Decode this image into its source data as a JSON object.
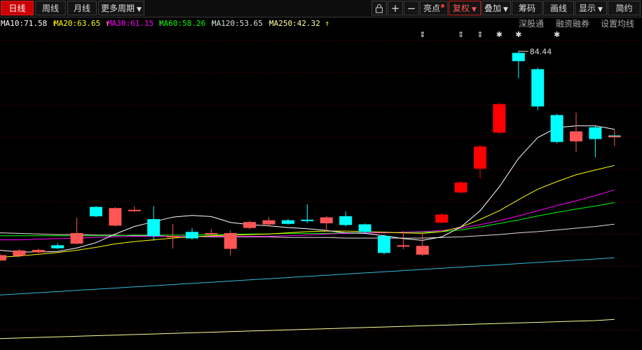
{
  "toolbar": {
    "period_day": "日线",
    "period_week": "周线",
    "period_month": "月线",
    "period_more": "更多周期",
    "lock_icon": "lock-icon",
    "zoom_in": "+",
    "zoom_out": "−",
    "bright_spot": "亮点",
    "adjust": "复权",
    "overlay": "叠加",
    "chips": "筹码",
    "draw_line": "画线",
    "display": "显示",
    "simple": "简约"
  },
  "ma_legend": [
    {
      "label": "MA10:71.58",
      "arrow": "↑",
      "color": "#ffffff"
    },
    {
      "label": "MA20:63.65",
      "arrow": "↑",
      "color": "#ffff00"
    },
    {
      "label": "MA30:61.15",
      "arrow": "↑",
      "color": "#ff00ff"
    },
    {
      "label": "MA60:58.26",
      "arrow": "↑",
      "color": "#00ff00"
    },
    {
      "label": "MA120:53.65",
      "arrow": "↑",
      "color": "#dddddd"
    },
    {
      "label": "MA250:42.32",
      "arrow": "↑",
      "color": "#ffffa0"
    }
  ],
  "links": {
    "shenzhen_connect": "深股通",
    "margin_trading": "融资融券",
    "ma_settings": "设置均线"
  },
  "chart_data": {
    "type": "candlestick",
    "annotations": {
      "max_label": "84.44"
    },
    "colors": {
      "up": "#ff5555",
      "up_strong": "#ff0000",
      "down": "#00ffff",
      "ma10": "#ffffff",
      "ma20": "#ffff00",
      "ma30": "#ff00ff",
      "ma60": "#00ff00",
      "ma120": "#dddddd",
      "ma250": "#ffff99",
      "extra": "#33bbdd"
    },
    "candles": [
      {
        "open": 48.5,
        "close": 49.3,
        "high": 49.6,
        "low": 48.3
      },
      {
        "open": 49.3,
        "close": 50.1,
        "high": 50.4,
        "low": 49.0
      },
      {
        "open": 49.9,
        "close": 50.2,
        "high": 50.5,
        "low": 49.7
      },
      {
        "open": 51.0,
        "close": 50.6,
        "high": 51.4,
        "low": 50.4
      },
      {
        "open": 51.4,
        "close": 53.1,
        "high": 55.8,
        "low": 51.2
      },
      {
        "open": 57.6,
        "close": 56.1,
        "high": 57.8,
        "low": 55.9
      },
      {
        "open": 54.5,
        "close": 57.4,
        "high": 57.6,
        "low": 54.3
      },
      {
        "open": 57.0,
        "close": 57.1,
        "high": 57.8,
        "low": 56.8
      },
      {
        "open": 55.5,
        "close": 52.7,
        "high": 57.8,
        "low": 51.8
      },
      {
        "open": 52.6,
        "close": 52.6,
        "high": 54.7,
        "low": 50.5
      },
      {
        "open": 53.3,
        "close": 52.3,
        "high": 54.0,
        "low": 52.0
      },
      {
        "open": 53.0,
        "close": 53.1,
        "high": 53.8,
        "low": 52.8
      },
      {
        "open": 50.5,
        "close": 53.1,
        "high": 53.6,
        "low": 49.3
      },
      {
        "open": 54.1,
        "close": 55.0,
        "high": 55.3,
        "low": 53.8
      },
      {
        "open": 54.7,
        "close": 55.3,
        "high": 55.9,
        "low": 54.4
      },
      {
        "open": 55.3,
        "close": 54.8,
        "high": 55.6,
        "low": 54.6
      },
      {
        "open": 55.4,
        "close": 55.3,
        "high": 58.1,
        "low": 54.9
      },
      {
        "open": 54.9,
        "close": 55.8,
        "high": 56.1,
        "low": 53.5
      },
      {
        "open": 56.0,
        "close": 54.6,
        "high": 56.9,
        "low": 54.3
      },
      {
        "open": 54.6,
        "close": 53.4,
        "high": 54.8,
        "low": 53.0
      },
      {
        "open": 52.6,
        "close": 49.8,
        "high": 52.9,
        "low": 49.5
      },
      {
        "open": 51.0,
        "close": 51.0,
        "high": 53.5,
        "low": 50.4
      },
      {
        "open": 49.5,
        "close": 50.9,
        "high": 53.3,
        "low": 49.2
      },
      {
        "open": 55.0,
        "close": 56.3,
        "high": 56.6,
        "low": 54.8
      },
      {
        "open": 60.2,
        "close": 61.8,
        "high": 62.1,
        "low": 60.0
      },
      {
        "open": 64.3,
        "close": 68.0,
        "high": 68.3,
        "low": 62.6
      },
      {
        "open": 70.5,
        "close": 75.3,
        "high": 75.6,
        "low": 70.2
      },
      {
        "open": 84.1,
        "close": 82.8,
        "high": 84.44,
        "low": 79.8
      },
      {
        "open": 81.3,
        "close": 75.0,
        "high": 81.6,
        "low": 74.3
      },
      {
        "open": 73.4,
        "close": 68.9,
        "high": 73.7,
        "low": 68.6
      },
      {
        "open": 69.0,
        "close": 70.6,
        "high": 73.9,
        "low": 67.1
      },
      {
        "open": 71.3,
        "close": 69.4,
        "high": 71.6,
        "low": 66.2
      },
      {
        "open": 69.7,
        "close": 69.9,
        "high": 70.9,
        "low": 68.1
      }
    ],
    "ma10": [
      50.2,
      49.9,
      49.9,
      50.0,
      50.6,
      51.5,
      53.0,
      54.3,
      55.1,
      55.9,
      56.2,
      56.0,
      55.0,
      54.6,
      54.4,
      54.1,
      53.9,
      53.6,
      53.2,
      53.1,
      52.7,
      52.2,
      51.9,
      52.5,
      54.2,
      57.0,
      61.1,
      66.0,
      69.6,
      71.3,
      71.6,
      71.6,
      71.0
    ],
    "ma20": [
      49.0,
      49.2,
      49.5,
      49.8,
      50.2,
      50.7,
      51.3,
      51.7,
      52.0,
      52.3,
      52.5,
      52.7,
      52.8,
      52.9,
      53.0,
      53.2,
      53.4,
      53.5,
      53.5,
      53.4,
      53.3,
      53.2,
      53.1,
      53.4,
      54.2,
      55.5,
      57.0,
      58.9,
      60.7,
      62.0,
      63.2,
      64.0,
      64.8
    ],
    "ma30": [
      52.0,
      52.0,
      52.1,
      52.2,
      52.3,
      52.4,
      52.5,
      52.6,
      52.6,
      52.6,
      52.6,
      52.6,
      52.6,
      52.6,
      52.6,
      52.7,
      52.8,
      53.0,
      53.1,
      53.2,
      53.2,
      53.3,
      53.4,
      53.6,
      54.0,
      54.6,
      55.3,
      56.1,
      57.0,
      57.9,
      58.7,
      59.6,
      60.6
    ],
    "ma60": [
      52.7,
      52.7,
      52.7,
      52.7,
      52.7,
      52.7,
      52.7,
      52.8,
      52.8,
      52.8,
      52.8,
      52.9,
      52.9,
      53.0,
      53.0,
      53.1,
      53.1,
      53.1,
      53.2,
      53.2,
      53.2,
      53.3,
      53.3,
      53.4,
      53.7,
      54.2,
      54.8,
      55.4,
      56.1,
      56.7,
      57.3,
      57.8,
      58.4
    ],
    "ma120": [
      53.2,
      53.1,
      53.0,
      52.9,
      52.9,
      52.8,
      52.8,
      52.7,
      52.7,
      52.6,
      52.6,
      52.5,
      52.5,
      52.5,
      52.5,
      52.4,
      52.4,
      52.4,
      52.3,
      52.3,
      52.3,
      52.3,
      52.3,
      52.4,
      52.5,
      52.7,
      52.9,
      53.2,
      53.4,
      53.7,
      54.0,
      54.3,
      54.7
    ],
    "extra_line": [
      42.5,
      42.7,
      42.9,
      43.1,
      43.3,
      43.5,
      43.7,
      43.9,
      44.1,
      44.3,
      44.5,
      44.7,
      44.9,
      45.1,
      45.3,
      45.5,
      45.7,
      45.9,
      46.1,
      46.3,
      46.5,
      46.7,
      46.9,
      47.1,
      47.3,
      47.5,
      47.7,
      47.9,
      48.1,
      48.3,
      48.5,
      48.7,
      48.9
    ],
    "ma250": [
      35.0,
      35.1,
      35.2,
      35.3,
      35.4,
      35.5,
      35.6,
      35.7,
      35.8,
      35.9,
      36.0,
      36.1,
      36.2,
      36.3,
      36.4,
      36.5,
      36.6,
      36.7,
      36.8,
      36.9,
      37.0,
      37.1,
      37.2,
      37.3,
      37.4,
      37.5,
      37.6,
      37.7,
      37.8,
      37.9,
      38.0,
      38.1,
      38.3
    ],
    "markers": [
      {
        "index": 22,
        "symbol": "⇕"
      },
      {
        "index": 24,
        "symbol": "⇕"
      },
      {
        "index": 25,
        "symbol": "⇕"
      },
      {
        "index": 26,
        "symbol": "✱"
      },
      {
        "index": 27,
        "symbol": "✱"
      },
      {
        "index": 29,
        "symbol": "✱"
      }
    ],
    "ylim": [
      34,
      87
    ]
  }
}
